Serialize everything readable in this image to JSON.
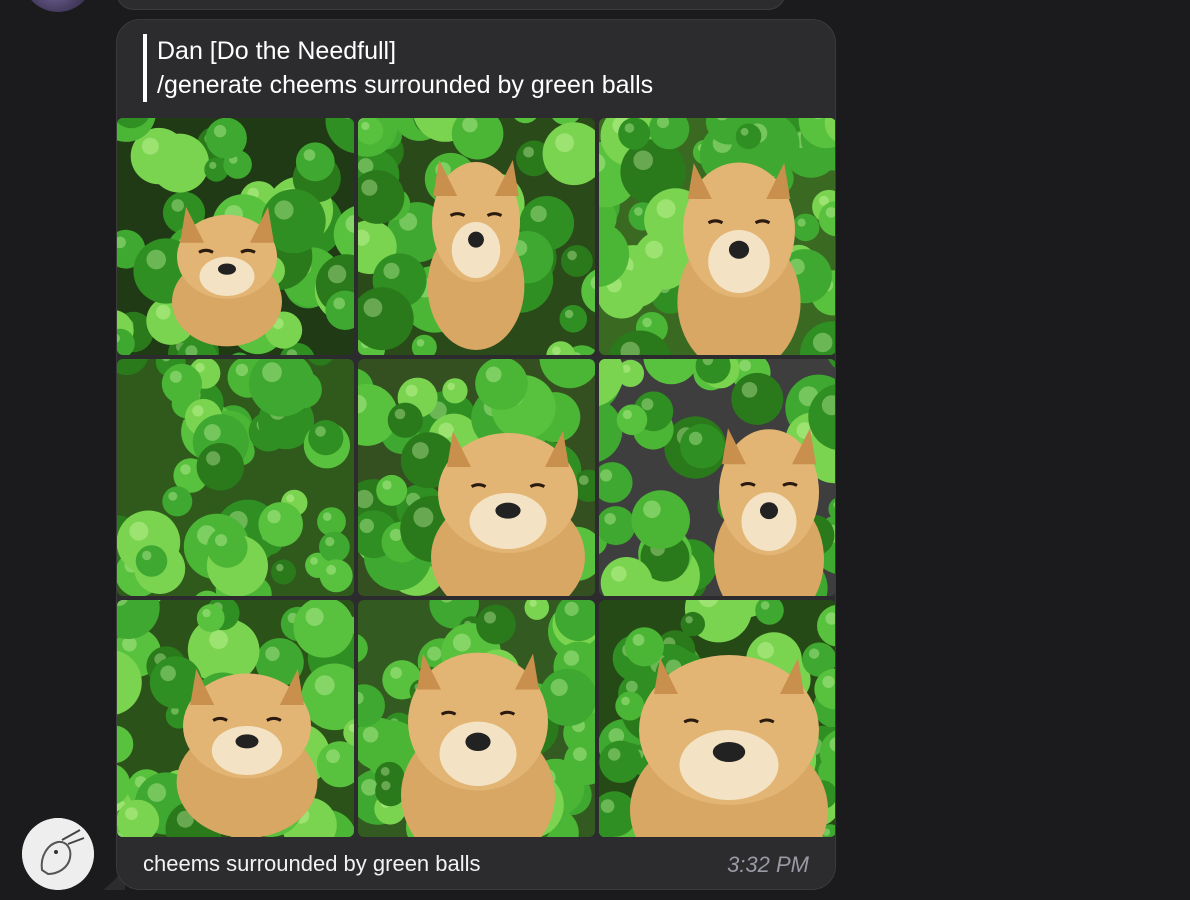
{
  "reply": {
    "author": "Dan [Do the Needfull]",
    "text": "/generate cheems surrounded by green balls"
  },
  "message": {
    "caption": "cheems surrounded by green balls",
    "time": "3:32 PM"
  },
  "images": [
    {
      "name": "generated-image-1"
    },
    {
      "name": "generated-image-2"
    },
    {
      "name": "generated-image-3"
    },
    {
      "name": "generated-image-4"
    },
    {
      "name": "generated-image-5"
    },
    {
      "name": "generated-image-6"
    },
    {
      "name": "generated-image-7"
    },
    {
      "name": "generated-image-8"
    },
    {
      "name": "generated-image-9"
    }
  ],
  "colors": {
    "background": "#1b1b1d",
    "bubble": "#2c2c2e",
    "timestamp": "#9a9aa6",
    "ball_green": "#3fa830",
    "dog_tan": "#d9a35f"
  }
}
